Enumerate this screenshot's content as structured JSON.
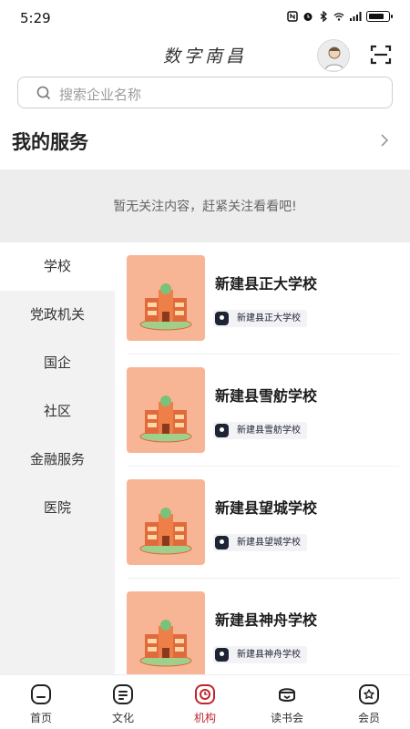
{
  "status_bar": {
    "time": "5:29"
  },
  "header": {
    "title": "数字南昌"
  },
  "search": {
    "placeholder": "搜索企业名称"
  },
  "services": {
    "title": "我的服务",
    "empty_text": "暂无关注内容，赶紧关注看看吧!"
  },
  "categories": [
    {
      "label": "学校",
      "active": true
    },
    {
      "label": "党政机关"
    },
    {
      "label": "国企"
    },
    {
      "label": "社区"
    },
    {
      "label": "金融服务"
    },
    {
      "label": "医院"
    }
  ],
  "items": [
    {
      "name": "新建县正大学校",
      "tag": "新建县正大学校"
    },
    {
      "name": "新建县雪舫学校",
      "tag": "新建县雪舫学校"
    },
    {
      "name": "新建县望城学校",
      "tag": "新建县望城学校"
    },
    {
      "name": "新建县神舟学校",
      "tag": "新建县神舟学校"
    }
  ],
  "bottom_nav": [
    {
      "label": "首页",
      "icon": "home-icon"
    },
    {
      "label": "文化",
      "icon": "culture-icon"
    },
    {
      "label": "机构",
      "icon": "institution-icon",
      "active": true
    },
    {
      "label": "读书会",
      "icon": "book-club-icon"
    },
    {
      "label": "会员",
      "icon": "member-icon"
    }
  ],
  "colors": {
    "accent": "#c0262d",
    "thumb_bg": "#f7b595",
    "sidebar_bg": "#f2f2f2",
    "empty_bg": "#ededed"
  }
}
